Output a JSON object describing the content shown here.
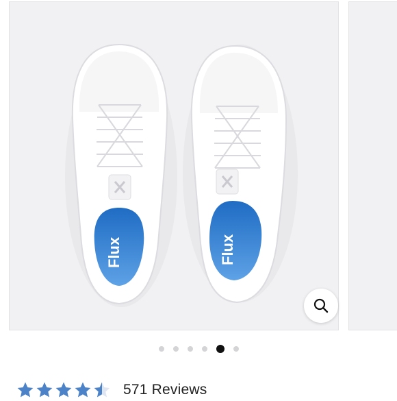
{
  "product_gallery": {
    "insole_brand_text": "Flux",
    "zoom_icon": "magnifier-icon",
    "slide_count": 6,
    "active_slide_index": 4
  },
  "rating": {
    "value": 4.5,
    "max": 5,
    "reviews_label": "571 Reviews"
  },
  "colors": {
    "star": "#4c82c8",
    "insole_blue": "#2f7fd0",
    "slide_background": "#f1f1f3",
    "active_dot": "#111111",
    "inactive_dot": "#d4d4d6"
  }
}
